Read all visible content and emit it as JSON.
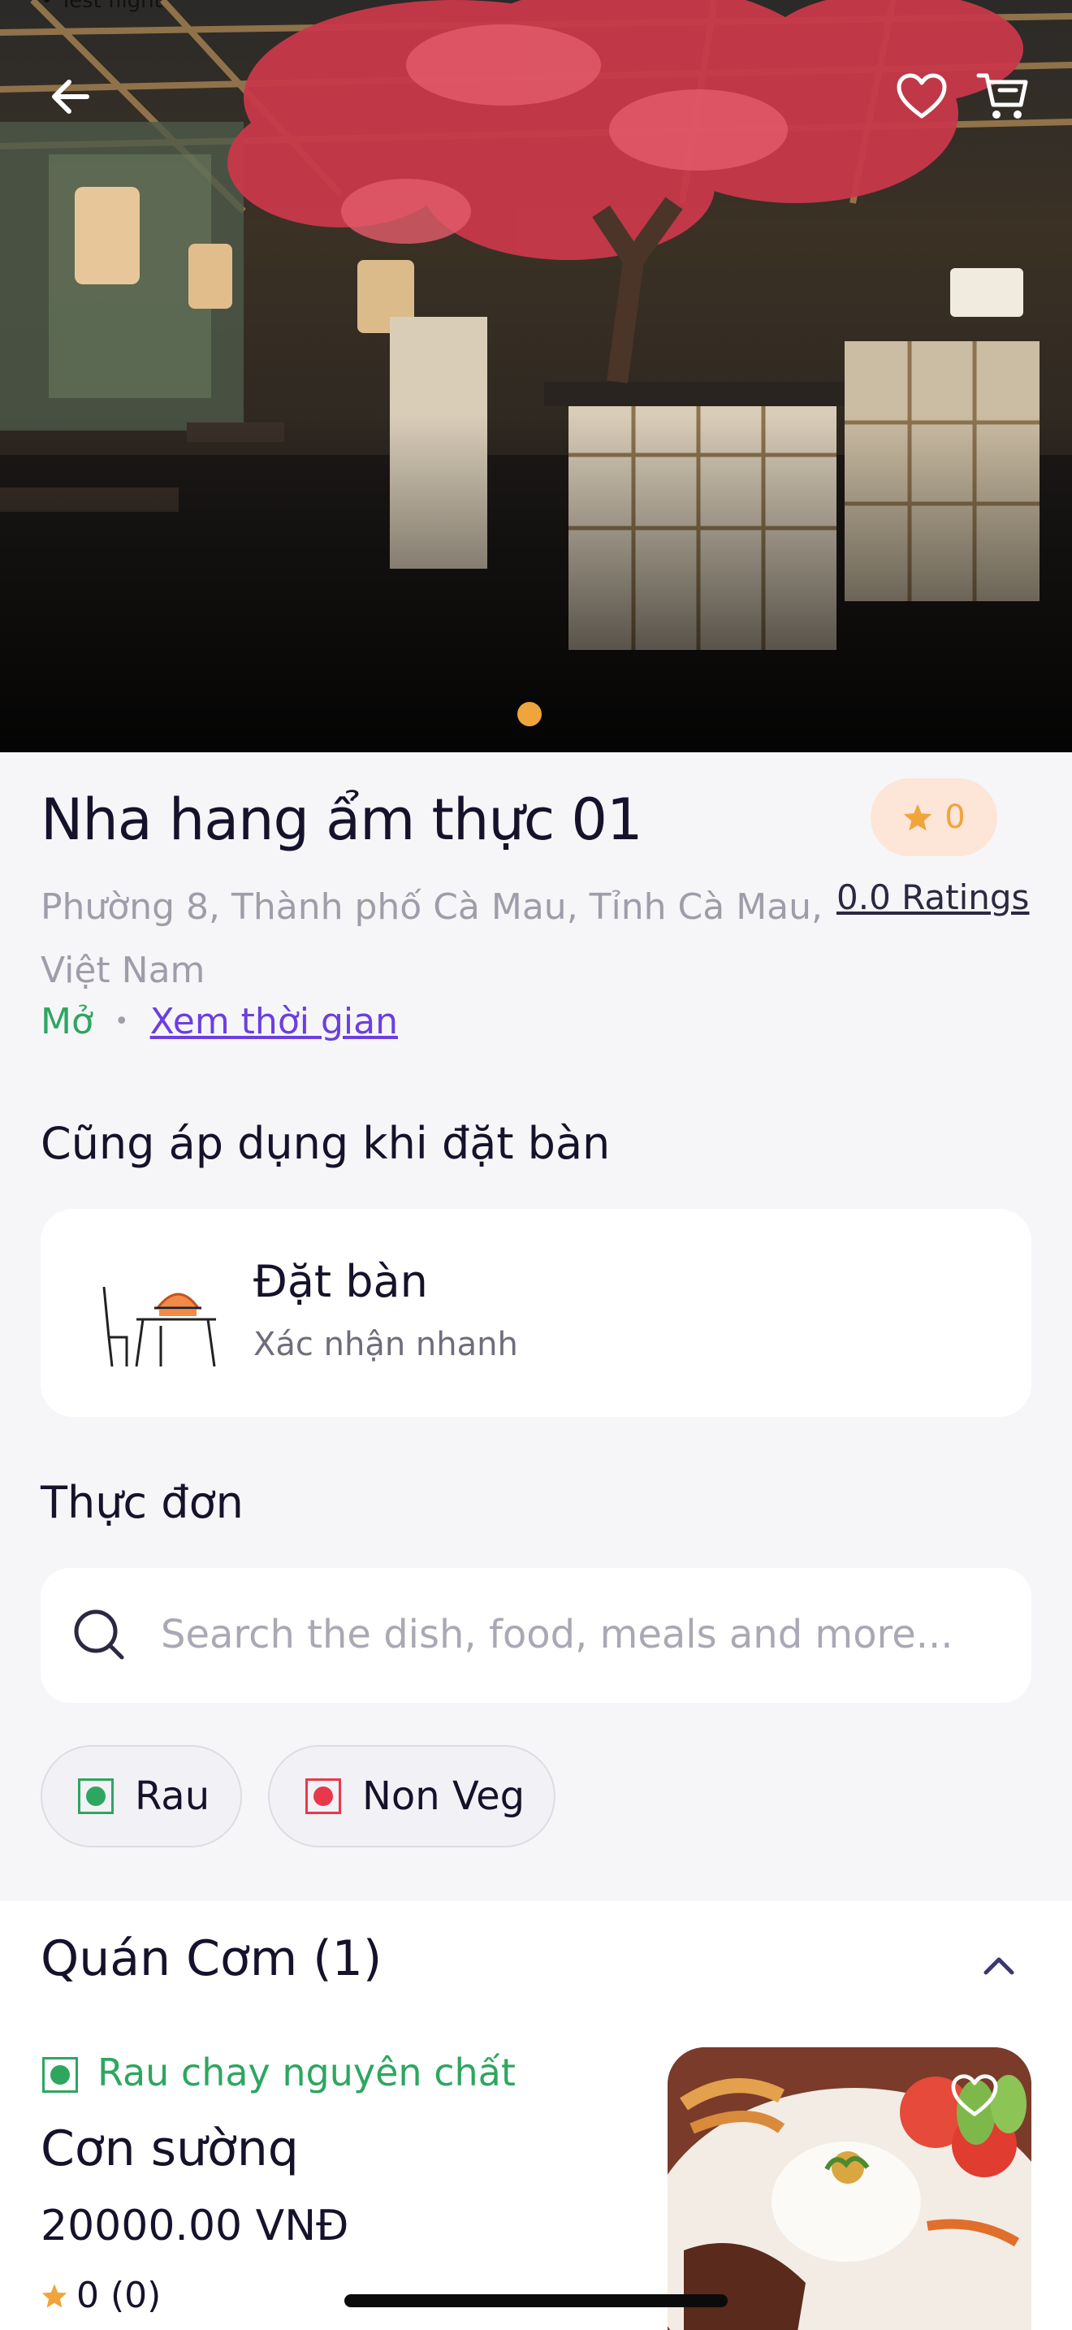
{
  "status_bar": {
    "time_partial": "• Test flight"
  },
  "hero": {
    "back_icon": "arrow-left-icon",
    "favorite_icon": "heart-outline-icon",
    "cart_icon": "shopping-cart-icon",
    "carousel_active_color": "#f0a43c"
  },
  "restaurant": {
    "name": "Nha hang ẩm thực 01",
    "rating_value": "0",
    "address": "Phường 8, Thành phố Cà Mau, Tỉnh Cà Mau, Việt Nam",
    "ratings_link": "0.0 Ratings",
    "open_status": "Mở",
    "separator": "•",
    "hours_link": "Xem thời gian"
  },
  "booking_section": {
    "heading": "Cũng áp dụng khi đặt bàn",
    "title": "Đặt bàn",
    "subtitle": "Xác nhận nhanh"
  },
  "menu_section": {
    "heading": "Thực đơn",
    "search_placeholder": "Search the dish, food, meals and more...",
    "filters": [
      {
        "label": "Rau",
        "color": "#2ea660"
      },
      {
        "label": "Non Veg",
        "color": "#e8394a"
      }
    ]
  },
  "menu": {
    "category": "Quán Cơm (1)",
    "items": [
      {
        "diet_label": "Rau chay nguyên chất",
        "name": "Cơn sườnq",
        "price": "20000.00 VNĐ",
        "rating": "0 (0)"
      }
    ]
  },
  "colors": {
    "accent_purple": "#6b3fe0",
    "veg_green": "#2ea660",
    "nonveg_red": "#e8394a",
    "star_orange": "#f0a43c"
  }
}
